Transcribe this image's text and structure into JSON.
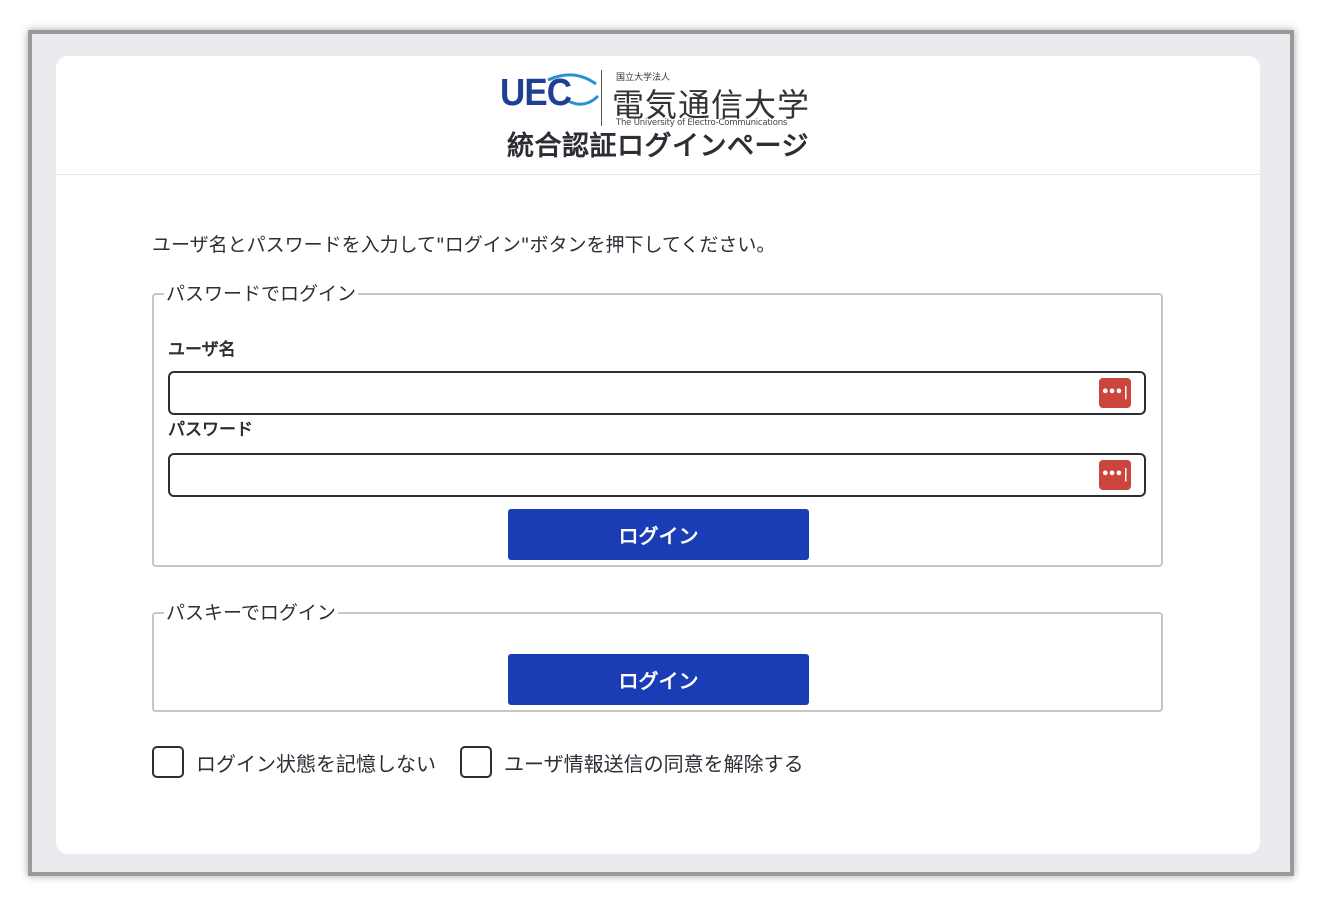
{
  "header": {
    "logo_mark": "UEC",
    "logo_small_top": "国立大学法人",
    "logo_university_name": "電気通信大学",
    "logo_university_en": "The University of Electro-Communications",
    "page_title": "統合認証ログインページ"
  },
  "instruction": "ユーザ名とパスワードを入力して\"ログイン\"ボタンを押下してください。",
  "password_login": {
    "legend": "パスワードでログイン",
    "username_label": "ユーザ名",
    "username_value": "",
    "password_label": "パスワード",
    "password_value": "",
    "password_manager_icon": "•••|",
    "button_label": "ログイン"
  },
  "passkey_login": {
    "legend": "パスキーでログイン",
    "button_label": "ログイン"
  },
  "options": {
    "dont_remember": {
      "label": "ログイン状態を記憶しない",
      "checked": false
    },
    "revoke_consent": {
      "label": "ユーザ情報送信の同意を解除する",
      "checked": false
    }
  },
  "colors": {
    "primary_button": "#1a3db5",
    "logo_blue": "#1f3f93",
    "password_manager_badge": "#c9453d",
    "background": "#e9ebee"
  }
}
